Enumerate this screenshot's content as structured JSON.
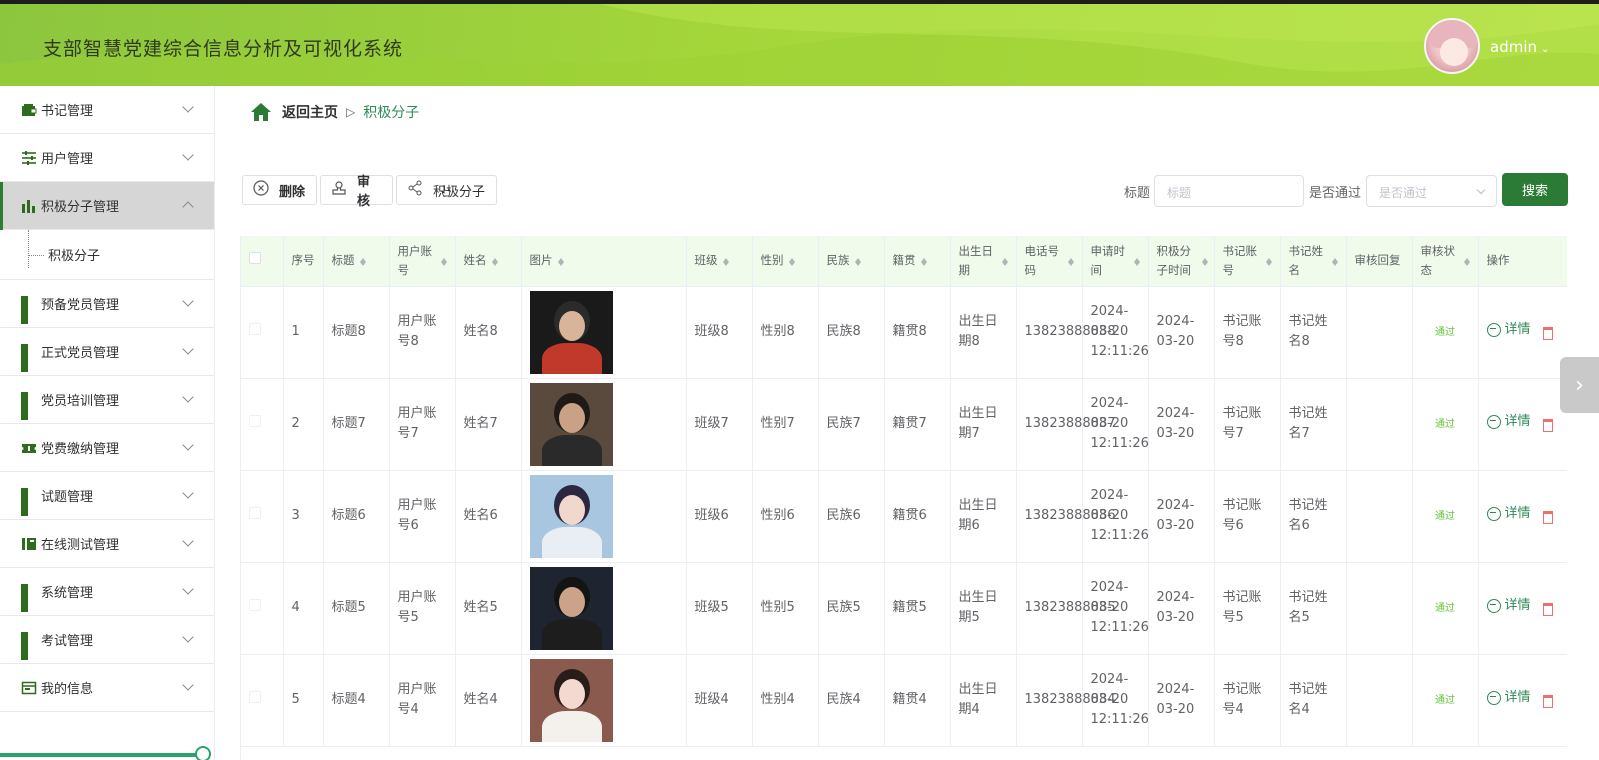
{
  "header": {
    "title": "支部智慧党建综合信息分析及可视化系统",
    "user": "admin"
  },
  "sidebar": {
    "items": [
      {
        "label": "书记管理",
        "icon": "wallet-icon"
      },
      {
        "label": "用户管理",
        "icon": "sliders-icon"
      },
      {
        "label": "积极分子管理",
        "icon": "bar-chart-icon",
        "active": true
      },
      {
        "label": "预备党员管理",
        "icon": "grid-icon"
      },
      {
        "label": "正式党员管理",
        "icon": "grid-icon"
      },
      {
        "label": "党员培训管理",
        "icon": "grid-icon"
      },
      {
        "label": "党费缴纳管理",
        "icon": "ticket-icon"
      },
      {
        "label": "试题管理",
        "icon": "grid-icon"
      },
      {
        "label": "在线测试管理",
        "icon": "book-icon"
      },
      {
        "label": "系统管理",
        "icon": "grid-icon"
      },
      {
        "label": "考试管理",
        "icon": "grid-icon"
      },
      {
        "label": "我的信息",
        "icon": "id-card-icon"
      }
    ],
    "submenu_label": "积极分子"
  },
  "breadcrumb": {
    "home": "返回主页",
    "separator": "▷",
    "current": "积极分子"
  },
  "toolbar": {
    "delete": "删除",
    "audit": "审核",
    "share": "积极分子"
  },
  "filters": {
    "title_label": "标题",
    "title_placeholder": "标题",
    "pass_label": "是否通过",
    "pass_placeholder": "是否通过",
    "search": "搜索"
  },
  "table": {
    "headers": [
      "序号",
      "标题",
      "用户账号",
      "姓名",
      "图片",
      "班级",
      "性别",
      "民族",
      "籍贯",
      "出生日期",
      "电话号码",
      "申请时间",
      "积极分子时间",
      "书记账号",
      "书记姓名",
      "审核回复",
      "审核状态",
      "操作"
    ],
    "detail_label": "详情",
    "rows": [
      {
        "no": "1",
        "title": "标题8",
        "account": "用户账号8",
        "name": "姓名8",
        "class": "班级8",
        "gender": "性别8",
        "ethnic": "民族8",
        "native": "籍贯8",
        "birth": "出生日期8",
        "phone": "13823888888",
        "apply": "2024-03-20 12:11:26",
        "activist": "2024-03-20",
        "sec_acc": "书记账号8",
        "sec_name": "书记姓名8",
        "reply": "",
        "status": "通过"
      },
      {
        "no": "2",
        "title": "标题7",
        "account": "用户账号7",
        "name": "姓名7",
        "class": "班级7",
        "gender": "性别7",
        "ethnic": "民族7",
        "native": "籍贯7",
        "birth": "出生日期7",
        "phone": "13823888887",
        "apply": "2024-03-20 12:11:26",
        "activist": "2024-03-20",
        "sec_acc": "书记账号7",
        "sec_name": "书记姓名7",
        "reply": "",
        "status": "通过"
      },
      {
        "no": "3",
        "title": "标题6",
        "account": "用户账号6",
        "name": "姓名6",
        "class": "班级6",
        "gender": "性别6",
        "ethnic": "民族6",
        "native": "籍贯6",
        "birth": "出生日期6",
        "phone": "13823888886",
        "apply": "2024-03-20 12:11:26",
        "activist": "2024-03-20",
        "sec_acc": "书记账号6",
        "sec_name": "书记姓名6",
        "reply": "",
        "status": "通过"
      },
      {
        "no": "4",
        "title": "标题5",
        "account": "用户账号5",
        "name": "姓名5",
        "class": "班级5",
        "gender": "性别5",
        "ethnic": "民族5",
        "native": "籍贯5",
        "birth": "出生日期5",
        "phone": "13823888885",
        "apply": "2024-03-20 12:11:26",
        "activist": "2024-03-20",
        "sec_acc": "书记账号5",
        "sec_name": "书记姓名5",
        "reply": "",
        "status": "通过"
      },
      {
        "no": "5",
        "title": "标题4",
        "account": "用户账号4",
        "name": "姓名4",
        "class": "班级4",
        "gender": "性别4",
        "ethnic": "民族4",
        "native": "籍贯4",
        "birth": "出生日期4",
        "phone": "13823888884",
        "apply": "2024-03-20 12:11:26",
        "activist": "2024-03-20",
        "sec_acc": "书记账号4",
        "sec_name": "书记姓名4",
        "reply": "",
        "status": "通过"
      }
    ]
  },
  "colors": {
    "header": "#a4d63a",
    "primary": "#2b7a35",
    "status": "#67c23a",
    "table_header": "#f0fbeb"
  }
}
